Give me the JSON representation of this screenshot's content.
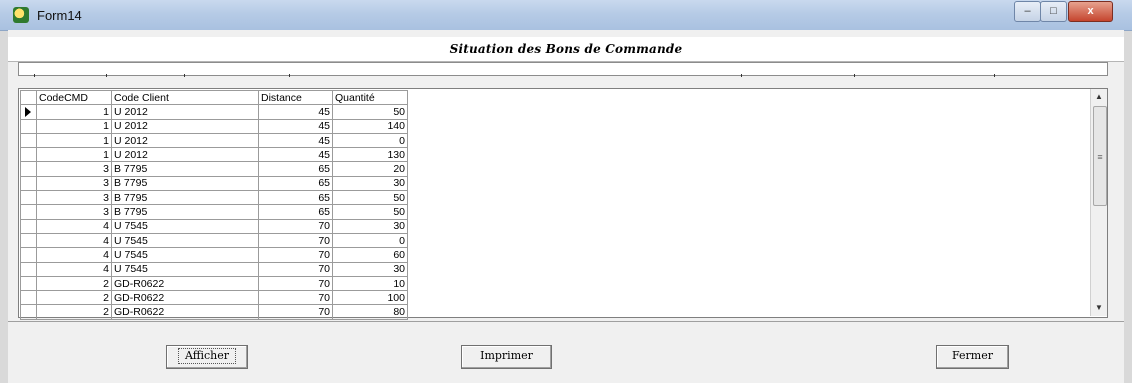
{
  "window": {
    "title": "Form14",
    "min_label": "–",
    "max_label": "□",
    "close_label": "x"
  },
  "heading": "Situation des Bons de Commande",
  "table": {
    "columns": [
      "CodeCMD",
      "Code Client",
      "Distance",
      "Quantité"
    ],
    "rows": [
      [
        "1",
        "U 2012",
        "45",
        "50"
      ],
      [
        "1",
        "U 2012",
        "45",
        "140"
      ],
      [
        "1",
        "U 2012",
        "45",
        "0"
      ],
      [
        "1",
        "U 2012",
        "45",
        "130"
      ],
      [
        "3",
        "B 7795",
        "65",
        "20"
      ],
      [
        "3",
        "B 7795",
        "65",
        "30"
      ],
      [
        "3",
        "B 7795",
        "65",
        "50"
      ],
      [
        "3",
        "B 7795",
        "65",
        "50"
      ],
      [
        "4",
        "U 7545",
        "70",
        "30"
      ],
      [
        "4",
        "U 7545",
        "70",
        "0"
      ],
      [
        "4",
        "U 7545",
        "70",
        "60"
      ],
      [
        "4",
        "U 7545",
        "70",
        "30"
      ],
      [
        "2",
        "GD-R0622",
        "70",
        "10"
      ],
      [
        "2",
        "GD-R0622",
        "70",
        "100"
      ],
      [
        "2",
        "GD-R0622",
        "70",
        "80"
      ]
    ]
  },
  "buttons": {
    "afficher": "Afficher",
    "imprimer": "Imprimer",
    "fermer": "Fermer"
  }
}
